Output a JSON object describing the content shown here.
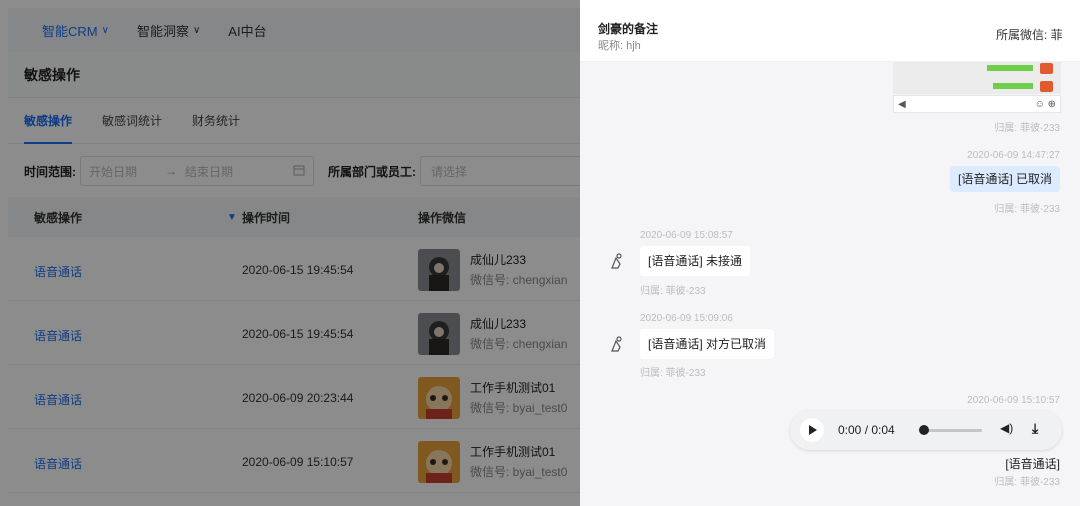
{
  "topnav": {
    "items": [
      {
        "label": "智能CRM",
        "active": true
      },
      {
        "label": "智能洞察",
        "active": false
      },
      {
        "label": "AI中台",
        "active": false
      }
    ]
  },
  "page": {
    "title": "敏感操作"
  },
  "tabs": [
    "敏感操作",
    "敏感词统计",
    "财务统计"
  ],
  "filters": {
    "time_label": "时间范围:",
    "start_placeholder": "开始日期",
    "range_sep": "→",
    "end_placeholder": "结束日期",
    "dept_label": "所属部门或员工:",
    "dept_placeholder": "请选择"
  },
  "table": {
    "headers": [
      "敏感操作",
      "操作时间",
      "操作微信"
    ],
    "rows": [
      {
        "op": "语音通话",
        "time": "2020-06-15 19:45:54",
        "name": "成仙儿233",
        "wx": "微信号: chengxian"
      },
      {
        "op": "语音通话",
        "time": "2020-06-15 19:45:54",
        "name": "成仙儿233",
        "wx": "微信号: chengxian"
      },
      {
        "op": "语音通话",
        "time": "2020-06-09 20:23:44",
        "name": "工作手机测试01",
        "wx": "微信号: byai_test0"
      },
      {
        "op": "语音通话",
        "time": "2020-06-09 15:10:57",
        "name": "工作手机测试01",
        "wx": "微信号: byai_test0"
      }
    ]
  },
  "drawer": {
    "title": "剑豪的备注",
    "nickname": "昵称: hjh",
    "owner_wechat": "所属微信: 菲",
    "messages": {
      "owner1": "归属: 菲彼-233",
      "time2": "2020-06-09 14:47:27",
      "bubble2": "[语音通话] 已取消",
      "owner2": "归属: 菲彼-233",
      "time3": "2020-06-09 15:08:57",
      "bubble3": "[语音通话] 未接通",
      "owner3": "归属: 菲彼-233",
      "time4": "2020-06-09 15:09:06",
      "bubble4": "[语音通话] 对方已取消",
      "owner4": "归属: 菲彼-233",
      "time5": "2020-06-09 15:10:57",
      "audio_time": "0:00 / 0:04",
      "audio_progress": 0,
      "caption5": "[语音通话]",
      "owner5": "归属: 菲彼-233"
    }
  },
  "colors": {
    "accent": "#1d6ef5",
    "bubble_right": "#dcebff",
    "overlay": "rgba(0,0,0,0.45)"
  }
}
